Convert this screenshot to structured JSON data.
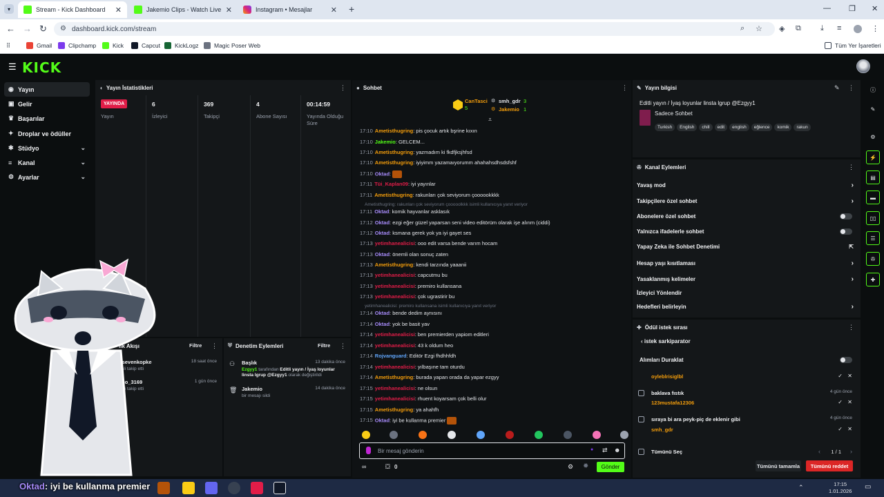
{
  "browser": {
    "tabs": [
      {
        "title": "Stream - Kick Dashboard",
        "active": true
      },
      {
        "title": "Jakemio Clips - Watch Live on K",
        "active": false
      },
      {
        "title": "Instagram • Mesajlar",
        "active": false
      }
    ],
    "url": "dashboard.kick.com/stream",
    "bookmarks": [
      "Gmail",
      "Clipchamp",
      "Kick",
      "Capcut",
      "KickLogz",
      "Magic Poser Web"
    ],
    "all_bookmarks": "Tüm Yer İşaretleri"
  },
  "sidebar": {
    "items": [
      {
        "label": "Yayın",
        "icon": "broadcast-icon",
        "active": true
      },
      {
        "label": "Gelir",
        "icon": "money-icon"
      },
      {
        "label": "Başarılar",
        "icon": "trophy-icon"
      },
      {
        "label": "Droplar ve ödüller",
        "icon": "gift-icon"
      },
      {
        "label": "Stüdyo",
        "icon": "studio-icon",
        "expandable": true
      },
      {
        "label": "Kanal",
        "icon": "channel-icon",
        "expandable": true
      },
      {
        "label": "Ayarlar",
        "icon": "settings-icon",
        "expandable": true
      }
    ]
  },
  "stats": {
    "title": "Yayın İstatistikleri",
    "live_badge": "YAYINDA",
    "columns": [
      {
        "value": "",
        "label": "Yayın"
      },
      {
        "value": "6",
        "label": "İzleyici"
      },
      {
        "value": "369",
        "label": "Takipçi"
      },
      {
        "value": "4",
        "label": "Abone Sayısı"
      },
      {
        "value": "00:14:59",
        "label": "Yayında Olduğu Süre"
      }
    ]
  },
  "followers": {
    "title": "lik Akışı",
    "filter": "Filtre",
    "rows": [
      {
        "name": "nsevenkopke",
        "sub": "nali takip etti",
        "time": "18 saat önce"
      },
      {
        "name": "cho_3169",
        "sub": "nali takip etti",
        "time": "1 gün önce"
      }
    ]
  },
  "moderation": {
    "title": "Denetim Eylemleri",
    "filter": "Filtre",
    "rows": [
      {
        "title": "Başlık",
        "user": "Ezgyy1",
        "mid": " tarafından ",
        "strong": "Editli yayın / İyaş loyunlar linsta lgrup @Ezgyy1",
        "tail": " olarak değiştirildi",
        "time": "13 dakika önce"
      },
      {
        "title": "Jakemio",
        "sub": "bir mesajı sildi",
        "time": "14 dakika önce"
      }
    ]
  },
  "chat": {
    "title": "Sohbet",
    "pinned": [
      {
        "name": "CanTasci",
        "count": "5"
      },
      {
        "name": "smh_gdr",
        "count": "3"
      },
      {
        "name": "Jakemio",
        "count": "1"
      }
    ],
    "messages": [
      {
        "t": "17:10",
        "u": "Ametisthugring",
        "c": "#f59e0b",
        "m": ": pis çocuk artık bşrine kıxın"
      },
      {
        "t": "17:10",
        "u": "Jakemio",
        "c": "#53fc18",
        "m": ": GELCEM..."
      },
      {
        "t": "17:10",
        "u": "Ametisthugring",
        "c": "#f59e0b",
        "m": ": yazmadım ki fkdfjksjhfsd"
      },
      {
        "t": "17:10",
        "u": "Ametisthugring",
        "c": "#f59e0b",
        "m": ": iyiyimm yazamaıyorumm ahahahsdhsdsfshf"
      },
      {
        "t": "17:10",
        "u": "Oktad",
        "c": "#a78bfa",
        "m": ":"
      },
      {
        "t": "17:11",
        "u": "Tüi_Kaplan09",
        "c": "#e11d48",
        "m": ": iyi yayınlar"
      },
      {
        "t": "17:11",
        "u": "Ametisthugring",
        "c": "#f59e0b",
        "m": ": rakunları çok seviyorum çoooookkkk"
      },
      {
        "t": "17:11",
        "u": "Oktad",
        "c": "#a78bfa",
        "m": ": komik hayvanlar asklasık"
      },
      {
        "t": "17:12",
        "u": "Oktad",
        "c": "#a78bfa",
        "m": ": ezgi eğer güzel yaparsan seni video editörüm olarak işe alırım (ciddi)"
      },
      {
        "t": "17:12",
        "u": "Oktad",
        "c": "#a78bfa",
        "m": ": ksmana gerek yok ya iyi gayet ses"
      },
      {
        "t": "17:13",
        "u": "yetimhanealicisi",
        "c": "#e11d48",
        "m": ": ooo edit varsa bende varım hocam"
      },
      {
        "t": "17:13",
        "u": "Oktad",
        "c": "#a78bfa",
        "m": ": önemli olan sonuç zaten"
      },
      {
        "t": "17:13",
        "u": "Ametisthugring",
        "c": "#f59e0b",
        "m": ": kendi tarzında yaaanii"
      },
      {
        "t": "17:13",
        "u": "yetimhanealicisi",
        "c": "#e11d48",
        "m": ": capcutmu bu"
      },
      {
        "t": "17:13",
        "u": "yetimhanealicisi",
        "c": "#e11d48",
        "m": ": premiro kullansana"
      },
      {
        "t": "17:13",
        "u": "yetimhanealicisi",
        "c": "#e11d48",
        "m": ": çok ugrastirir bu"
      },
      {
        "t": "17:14",
        "u": "Oktad",
        "c": "#a78bfa",
        "m": ": bende dedim aynısını"
      },
      {
        "t": "17:14",
        "u": "Oktad",
        "c": "#a78bfa",
        "m": ": yok be basit yav"
      },
      {
        "t": "17:14",
        "u": "yetimhanealicisi",
        "c": "#e11d48",
        "m": ": ben premierden yapiom editleri"
      },
      {
        "t": "17:14",
        "u": "yetimhanealicisi",
        "c": "#e11d48",
        "m": ": 43 k oldum heo"
      },
      {
        "t": "17:14",
        "u": "Rojvanguard",
        "c": "#60a5fa",
        "m": ": Editör Ezgi fhdhhfdh"
      },
      {
        "t": "17:14",
        "u": "yetimhanealicisi",
        "c": "#e11d48",
        "m": ": yılbaşıne tam oturdu"
      },
      {
        "t": "17:14",
        "u": "Ametisthugring",
        "c": "#f59e0b",
        "m": ": burada yapan orada da yapar ezgyy"
      },
      {
        "t": "17:15",
        "u": "yetimhanealicisi",
        "c": "#e11d48",
        "m": ": ne olsun"
      },
      {
        "t": "17:15",
        "u": "yetimhanealicisi",
        "c": "#e11d48",
        "m": ": rhuent koyarsam çok belli olur"
      },
      {
        "t": "17:15",
        "u": "Ametisthugring",
        "c": "#f59e0b",
        "m": ": ya ahahfh"
      },
      {
        "t": "17:15",
        "u": "Oktad",
        "c": "#a78bfa",
        "m": ": iyi be kullanma premier"
      }
    ],
    "replies": [
      "Ametisthugring: rakunları çok seviyorum çooooolkkk  isimli kullanıcıya yanıt veriyor",
      "yetimhanealicisi: premiro kullansana isimli kullanıcıya yanıt veriyor"
    ],
    "input_placeholder": "Bir mesaj gönderin",
    "points": "0",
    "send_label": "Gönder"
  },
  "stream_info": {
    "title": "Yayın bilgisi",
    "stream_title": "Editli yayın / İyaş loyunlar linsta lgrup @Ezgyy1",
    "category": "Sadece Sohbet",
    "tags": [
      "Turkish",
      "English",
      "chill",
      "edit",
      "english",
      "eğlence",
      "komik",
      "rakun"
    ]
  },
  "channel_actions": {
    "title": "Kanal Eylemleri",
    "rows": [
      {
        "label": "Yavaş mod",
        "control": "chevron"
      },
      {
        "label": "Takipçilere özel sohbet",
        "control": "chevron"
      },
      {
        "label": "Abonelere özel sohbet",
        "control": "toggle"
      },
      {
        "label": "Yalnızca ifadelerle sohbet",
        "control": "toggle"
      },
      {
        "label": "Yapay Zeka ile Sohbet Denetimi",
        "control": "external"
      },
      {
        "label": "Hesap yaşı kısıtlaması",
        "control": "chevron"
      },
      {
        "label": "Yasaklanmış kelimeler",
        "control": "chevron"
      },
      {
        "label": "İzleyici Yönlendir",
        "control": "none"
      },
      {
        "label": "Hedefleri belirleyin",
        "control": "chevron"
      }
    ]
  },
  "reward_queue": {
    "title": "Ödül istek sırası",
    "back_label": "istek sarkiparator",
    "pause_label": "Alımları Duraklat",
    "items": [
      {
        "title": "",
        "user": "oyleblrisiglbl",
        "time": ""
      },
      {
        "title": "baklava fıstık",
        "user": "123mustafa12306",
        "time": "4 gün önce"
      },
      {
        "title": "sıraya bi ara peyk-piç de eklenir gibi",
        "user": "smh_gdr",
        "time": "4 gün önce"
      }
    ],
    "select_all": "Tümünü Seç",
    "page": "1 / 1",
    "complete_all": "Tümünü tamamla",
    "reject_all": "Tümünü reddet"
  },
  "overlay": {
    "caption_user": "Oktad",
    "caption_text": "iyi be kullanma premier"
  },
  "taskbar": {
    "time": "17:15",
    "date": "1.01.2026"
  },
  "colors": {
    "kick_green": "#53fc18",
    "live_red": "#e11d48",
    "reject_red": "#dc2626",
    "panel_bg": "#141719",
    "page_bg": "#0b0e0f"
  }
}
